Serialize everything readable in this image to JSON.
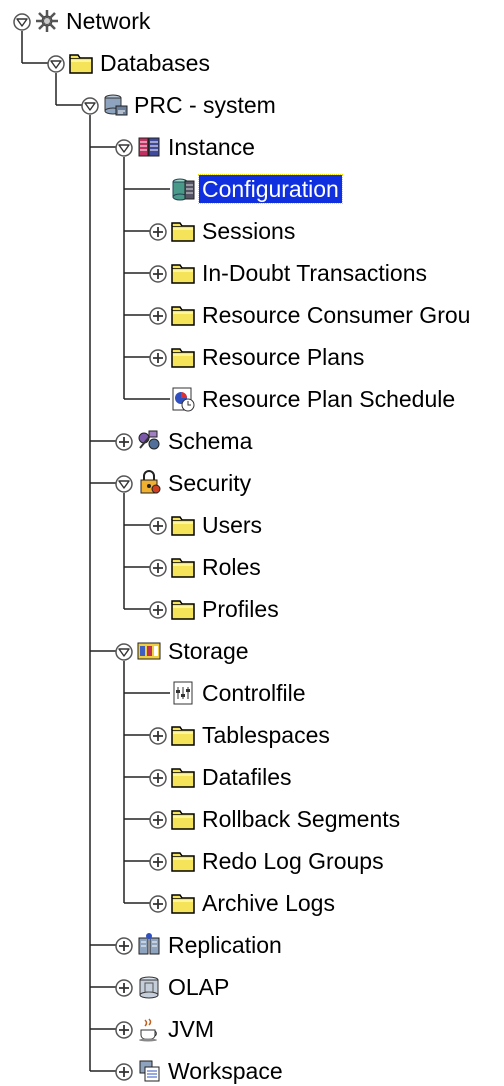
{
  "tree": {
    "nodes": [
      {
        "label": "Network",
        "icon": "network-icon",
        "toggle": "expanded",
        "level": 0,
        "name": "node-network"
      },
      {
        "label": "Databases",
        "icon": "folder-icon",
        "toggle": "expanded",
        "level": 1,
        "name": "node-databases"
      },
      {
        "label": "PRC - system",
        "icon": "database-connection-icon",
        "toggle": "expanded",
        "level": 2,
        "name": "node-prc-system"
      },
      {
        "label": "Instance",
        "icon": "instance-icon",
        "toggle": "expanded",
        "level": 3,
        "name": "node-instance"
      },
      {
        "label": "Configuration",
        "icon": "configuration-icon",
        "toggle": "none",
        "level": 4,
        "selected": true,
        "name": "node-configuration"
      },
      {
        "label": "Sessions",
        "icon": "folder-icon",
        "toggle": "collapsed",
        "level": 4,
        "name": "node-sessions"
      },
      {
        "label": "In-Doubt Transactions",
        "icon": "folder-icon",
        "toggle": "collapsed",
        "level": 4,
        "name": "node-in-doubt-transactions"
      },
      {
        "label": "Resource Consumer Grou",
        "icon": "folder-icon",
        "toggle": "collapsed",
        "level": 4,
        "name": "node-resource-consumer-groups"
      },
      {
        "label": "Resource Plans",
        "icon": "folder-icon",
        "toggle": "collapsed",
        "level": 4,
        "name": "node-resource-plans"
      },
      {
        "label": "Resource Plan Schedule",
        "icon": "schedule-icon",
        "toggle": "none",
        "level": 4,
        "name": "node-resource-plan-schedule"
      },
      {
        "label": "Schema",
        "icon": "schema-icon",
        "toggle": "collapsed",
        "level": 3,
        "name": "node-schema"
      },
      {
        "label": "Security",
        "icon": "security-lock-icon",
        "toggle": "expanded",
        "level": 3,
        "name": "node-security"
      },
      {
        "label": "Users",
        "icon": "folder-icon",
        "toggle": "collapsed",
        "level": 4,
        "name": "node-users"
      },
      {
        "label": "Roles",
        "icon": "folder-icon",
        "toggle": "collapsed",
        "level": 4,
        "name": "node-roles"
      },
      {
        "label": "Profiles",
        "icon": "folder-icon",
        "toggle": "collapsed",
        "level": 4,
        "name": "node-profiles"
      },
      {
        "label": "Storage",
        "icon": "storage-icon",
        "toggle": "expanded",
        "level": 3,
        "name": "node-storage"
      },
      {
        "label": "Controlfile",
        "icon": "controlfile-icon",
        "toggle": "none",
        "level": 4,
        "name": "node-controlfile"
      },
      {
        "label": "Tablespaces",
        "icon": "folder-icon",
        "toggle": "collapsed",
        "level": 4,
        "name": "node-tablespaces"
      },
      {
        "label": "Datafiles",
        "icon": "folder-icon",
        "toggle": "collapsed",
        "level": 4,
        "name": "node-datafiles"
      },
      {
        "label": "Rollback Segments",
        "icon": "folder-icon",
        "toggle": "collapsed",
        "level": 4,
        "name": "node-rollback-segments"
      },
      {
        "label": "Redo Log Groups",
        "icon": "folder-icon",
        "toggle": "collapsed",
        "level": 4,
        "name": "node-redo-log-groups"
      },
      {
        "label": "Archive Logs",
        "icon": "folder-icon",
        "toggle": "collapsed",
        "level": 4,
        "name": "node-archive-logs"
      },
      {
        "label": "Replication",
        "icon": "replication-icon",
        "toggle": "collapsed",
        "level": 3,
        "name": "node-replication"
      },
      {
        "label": "OLAP",
        "icon": "olap-icon",
        "toggle": "collapsed",
        "level": 3,
        "name": "node-olap"
      },
      {
        "label": "JVM",
        "icon": "jvm-icon",
        "toggle": "collapsed",
        "level": 3,
        "name": "node-jvm"
      },
      {
        "label": "Workspace",
        "icon": "workspace-icon",
        "toggle": "collapsed",
        "level": 3,
        "name": "node-workspace"
      }
    ]
  }
}
